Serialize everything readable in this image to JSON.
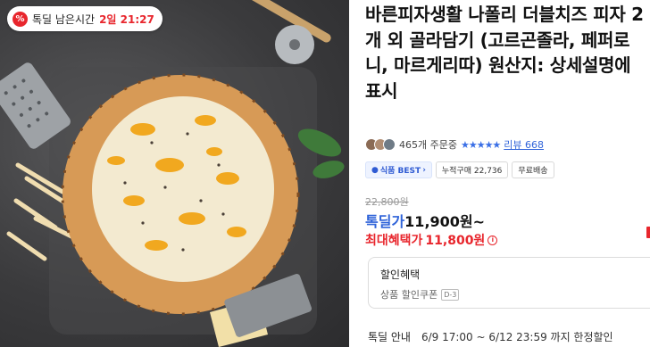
{
  "deal_badge": {
    "icon": "percent-tag-icon",
    "label": "톡딜 남은시간",
    "time": "2일 21:27"
  },
  "product": {
    "title": "바른피자생활 나폴리 더블치즈 피자 2개 외 골라담기 (고르곤졸라, 페퍼로니, 마르게리따) 원산지: 상세설명에 표시",
    "order_count": "465개 주문중",
    "rating_stars": "★★★★★",
    "review_link": "리뷰 668"
  },
  "tags": {
    "best": "식품 BEST",
    "purchases": "누적구매 22,736",
    "shipping": "무료배송"
  },
  "pricing": {
    "original": "22,800원",
    "deal_label": "톡딜가",
    "deal_value": "11,900원~",
    "max_label": "최대혜택가",
    "max_value": "11,800원",
    "info_icon": "i"
  },
  "discount": {
    "title": "할인혜택",
    "coupon_label": "상품 할인쿠폰",
    "dday": "D-3"
  },
  "deal_info": {
    "label": "톡딜 안내",
    "period": "6/9 17:00 ~ 6/12 23:59 까지 한정할인"
  },
  "colors": {
    "accent_red": "#e8262d",
    "accent_blue": "#2f63d9"
  }
}
